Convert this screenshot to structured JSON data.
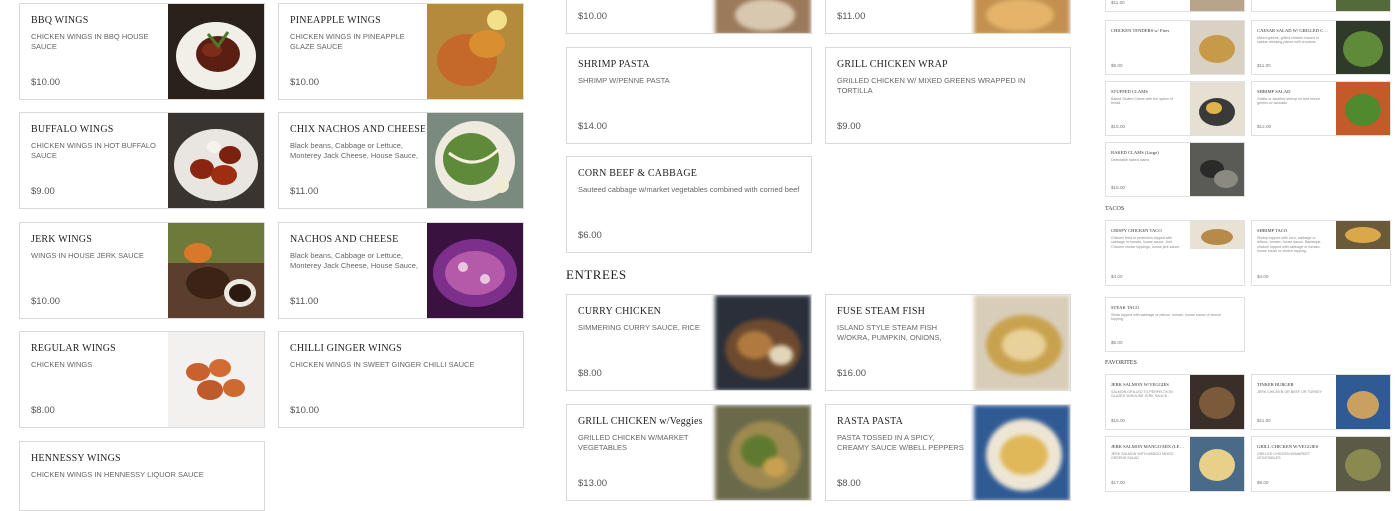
{
  "col1": [
    {
      "name": "BBQ WINGS",
      "desc": "CHICKEN WINGS IN BBQ HOUSE SAUCE",
      "price": "$10.00"
    },
    {
      "name": "BUFFALO WINGS",
      "desc": "CHICKEN WINGS IN HOT BUFFALO SAUCE",
      "price": "$9.00"
    },
    {
      "name": "JERK WINGS",
      "desc": "WINGS IN HOUSE JERK SAUCE",
      "price": "$10.00"
    },
    {
      "name": "REGULAR WINGS",
      "desc": "CHICKEN WINGS",
      "price": "$8.00"
    },
    {
      "name": "HENNESSY WINGS",
      "desc": "CHICKEN WINGS IN HENNESSY LIQUOR SAUCE",
      "price": ""
    }
  ],
  "col2": [
    {
      "name": "PINEAPPLE WINGS",
      "desc": "CHICKEN WINGS IN PINEAPPLE GLAZE SAUCE",
      "price": "$10.00"
    },
    {
      "name": "CHIX NACHOS AND CHEESE (…",
      "desc": "Black beans, Cabbage or Lettuce, Monterey Jack Cheese, House Sauce, Pic...",
      "price": "$11.00"
    },
    {
      "name": "NACHOS AND CHEESE",
      "desc": "Black beans, Cabbage or Lettuce, Monterey Jack Cheese, House Sauce, Pic...",
      "price": "$11.00"
    },
    {
      "name": "CHILLI GINGER WINGS",
      "desc": "CHICKEN WINGS IN SWEET GINGER CHILLI SAUCE",
      "price": "$10.00"
    }
  ],
  "col3": [
    {
      "name": "",
      "desc": "",
      "price": "$10.00"
    },
    {
      "name": "SHRIMP PASTA",
      "desc": "SHRIMP W/PENNE PASTA",
      "price": "$14.00"
    },
    {
      "name": "CORN BEEF & CABBAGE",
      "desc": "Sauteed cabbage w/market vegetables combined with corned beef",
      "price": "$6.00"
    }
  ],
  "col4": [
    {
      "name": "",
      "desc": "",
      "price": "$11.00"
    },
    {
      "name": "GRILL CHICKEN WRAP",
      "desc": "GRILLED CHICKEN W/ MIXED GREENS WRAPPED IN TORTILLA",
      "price": "$9.00"
    }
  ],
  "entrees_title": "ENTREES",
  "entrees": [
    {
      "name": "CURRY CHICKEN",
      "desc": "SIMMERING CURRY SAUCE, RICE",
      "price": "$8.00"
    },
    {
      "name": "FUSE STEAM FISH",
      "desc": "ISLAND STYLE STEAM FISH W/OKRA, PUMPKIN, ONIONS, CARROTS,...",
      "price": "$16.00"
    },
    {
      "name": "GRILL CHICKEN w/Veggies",
      "desc": "GRILLED CHICKEN W/MARKET VEGETABLES",
      "price": "$13.00"
    },
    {
      "name": "RASTA PASTA",
      "desc": "PASTA TOSSED IN A SPICY, CREAMY SAUCE W/BELL PEPPERS OR...",
      "price": "$8.00"
    }
  ],
  "mini": {
    "top": [
      {
        "name": "",
        "desc": "",
        "price": "$11.00"
      },
      {
        "name": "",
        "desc": "",
        "price": ""
      }
    ],
    "row1": [
      {
        "name": "CHICKEN TENDERS w/ Fries",
        "desc": "",
        "price": "$9.00"
      },
      {
        "name": "CAESAR SALAD W/ GRILLED C…",
        "desc": "Mixed greens, grilled chicken tossed in caesar dressing paired with croutons",
        "price": "$11.00"
      }
    ],
    "row2": [
      {
        "name": "STUFFED CLAMS",
        "desc": "Baked Stuffed Clams with the option of bread",
        "price": "$15.00"
      },
      {
        "name": "SHRIMP SALAD",
        "desc": "Grilled or sautéed shrimp on bed mixed greens w/ avocado",
        "price": "$12.00"
      }
    ],
    "row3": [
      {
        "name": "BAKED CLAMS (Large)",
        "desc": "Delectable baked clams",
        "price": "$15.00"
      }
    ],
    "tacos_title": "TACOS",
    "tacos": [
      {
        "name": "CRISPY CHICKEN TACO",
        "desc": "Chicken fried to perfection topped with cabbage or tomato, house sauce. Jerk Chicken choice toppings, house jerk sauce.",
        "price": "$4.00"
      },
      {
        "name": "SHRIMP TACO",
        "desc": "Shrimp topped with corn, cabbage or lettuce, tomato, house sauce. Barbeque chicken topped with cabbage or tomato, house sauce or choice topping.",
        "price": "$4.00"
      },
      {
        "name": "STEAK TACO",
        "desc": "Steak topped with cabbage or lettuce, tomato, house sauce of choice topping.",
        "price": "$6.00"
      }
    ],
    "fav_title": "FAVORITES",
    "favs": [
      {
        "name": "JERK SALMON W/VEGGIES",
        "desc": "SALMON GRILLED TO PERFECTION GLAZED W/HOUSE JERK SAUCE...",
        "price": "$15.00"
      },
      {
        "name": "TINKER BURGER",
        "desc": "JERK CHICKEN OR BEEF OR TURKEY",
        "price": "$11.00"
      },
      {
        "name": "JERK SALMON MANGO MIX (LE…",
        "desc": "JERK SALMON WITH MANGO MIXED GREENS SALAD",
        "price": "$17.00"
      },
      {
        "name": "GRILL CHICKEN W/VEGGIES",
        "desc": "GRILLED CHICKEN W/MARKET VEGETABLES",
        "price": "$9.00"
      }
    ]
  }
}
